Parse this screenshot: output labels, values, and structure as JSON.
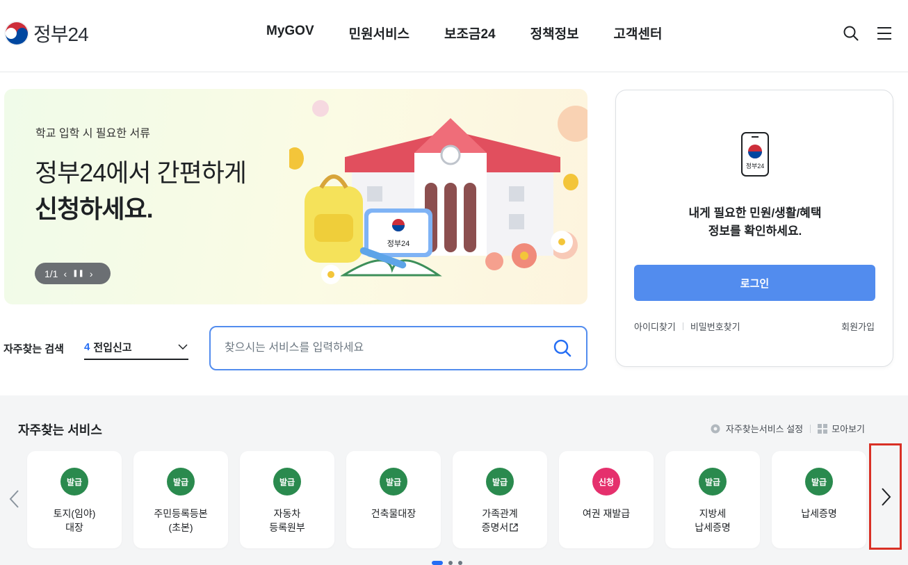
{
  "header": {
    "logo_text": "정부24",
    "nav": [
      "MyGOV",
      "민원서비스",
      "보조금24",
      "정책정보",
      "고객센터"
    ],
    "search_icon": "search-icon",
    "menu_icon": "hamburger-menu-icon"
  },
  "banner": {
    "subtitle": "학교 입학 시 필요한 서류",
    "title_line1": "정부24에서 간편하게",
    "title_line2": "신청하세요.",
    "pager_text": "1/1",
    "illustration_badge": "정부24"
  },
  "login": {
    "phone_label": "정부24",
    "message_line1": "내게 필요한 민원/생활/혜택",
    "message_line2": "정보를 확인하세요.",
    "login_button": "로그인",
    "find_id": "아이디찾기",
    "find_password": "비밀번호찾기",
    "signup": "회원가입"
  },
  "search": {
    "label": "자주찾는 검색",
    "selected_num": "4",
    "selected_text": "전입신고",
    "placeholder": "찾으시는 서비스를 입력하세요"
  },
  "services": {
    "title": "자주찾는 서비스",
    "settings_label": "자주찾는서비스 설정",
    "view_all_label": "모아보기",
    "items": [
      {
        "badge": "발급",
        "line1": "토지(임야)",
        "line2": "대장"
      },
      {
        "badge": "발급",
        "line1": "주민등록등본",
        "line2": "(초본)"
      },
      {
        "badge": "발급",
        "line1": "자동차",
        "line2": "등록원부"
      },
      {
        "badge": "발급",
        "line1": "건축물대장",
        "line2": ""
      },
      {
        "badge": "발급",
        "line1": "가족관계",
        "line2": "증명서"
      },
      {
        "badge": "신청",
        "line1": "여권 재발급",
        "line2": ""
      },
      {
        "badge": "발급",
        "line1": "지방세",
        "line2": "납세증명"
      },
      {
        "badge": "발급",
        "line1": "납세증명",
        "line2": ""
      }
    ],
    "page_dots": 3,
    "active_dot": 0
  },
  "colors": {
    "issue_badge": "#2a8a4e",
    "apply_badge": "#e5306d",
    "primary": "#528cee",
    "next_highlight": "#d93025"
  }
}
